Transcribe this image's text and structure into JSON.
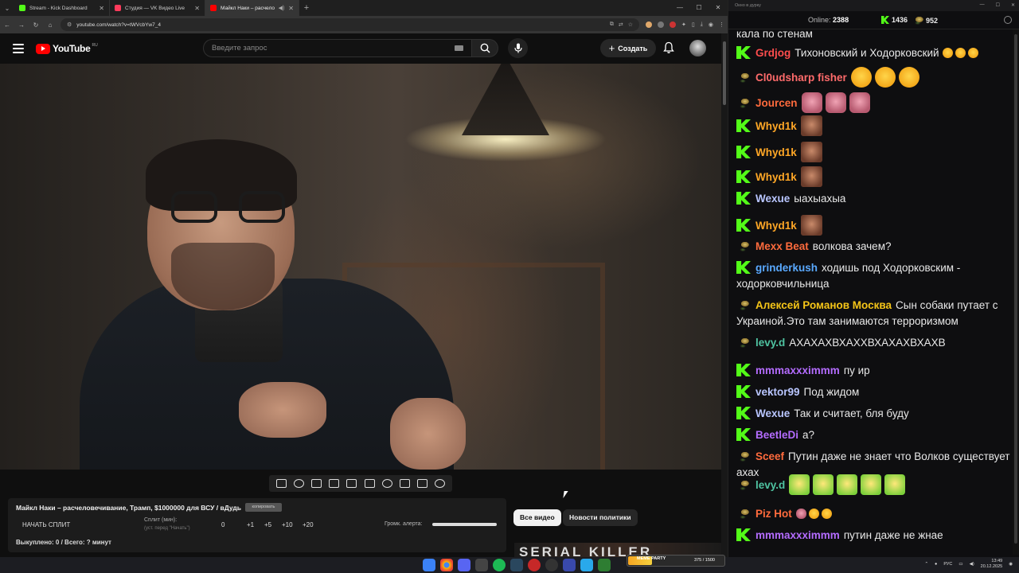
{
  "browser": {
    "tabs": [
      {
        "title": "Stream - Kick Dashboard",
        "color": "#53fc18",
        "active": false
      },
      {
        "title": "Студия — VK Видео Live",
        "color": "#ff3b5c",
        "active": false
      },
      {
        "title": "Майкл Наки – расчелове...",
        "color": "#ff0000",
        "active": true
      }
    ],
    "url": "youtube.com/watch?v=tWVcbYw7_4"
  },
  "youtube": {
    "logo_text": "YouTube",
    "logo_region": "RU",
    "search_placeholder": "Введите запрос",
    "create_label": "Создать"
  },
  "video_panel": {
    "title": "Майкл Наки – расчеловечивание, Трамп, $1000000 для ВСУ / вДудь",
    "copy_label": "копировать",
    "split_button": "НАЧАТЬ СПЛИТ",
    "split_label": "Сплит (мин):",
    "split_hint": "(уст. перед \"Начать\")",
    "steps": [
      "0",
      "+1",
      "+5",
      "+10",
      "+20"
    ],
    "volume_label": "Громк. алерта:",
    "bought": "Выкуплено: 0 / Всего: ? минут"
  },
  "chips": [
    "Все видео",
    "Новости политики"
  ],
  "thumb_text": "SERIAL KILLER",
  "chat": {
    "window_title": "Окно в дурку",
    "online_label": "Online:",
    "online_count": "2388",
    "kick_count": "1436",
    "vk_count": "952",
    "messages": [
      {
        "platform": "",
        "user": "",
        "color": "#e8e8e8",
        "text": "кала по стенам",
        "emotes": ""
      },
      {
        "platform": "kick",
        "user": "Grdjog",
        "color": "#ff4d4d",
        "text": "Тихоновский и Ходорковский",
        "emotes": "laugh-small x3"
      },
      {
        "platform": "vk",
        "user": "Cl0udsharp fisher",
        "color": "#ff6b6b",
        "text": "",
        "emotes": "laugh x3"
      },
      {
        "platform": "vk",
        "user": "Jourcen",
        "color": "#ff6b3d",
        "text": "",
        "emotes": "pink x3"
      },
      {
        "platform": "kick",
        "user": "Whyd1k",
        "color": "#ffa726",
        "text": "",
        "emotes": "face x1"
      },
      {
        "platform": "kick",
        "user": "Whyd1k",
        "color": "#ffa726",
        "text": "",
        "emotes": "face x1"
      },
      {
        "platform": "kick",
        "user": "Whyd1k",
        "color": "#ffa726",
        "text": "",
        "emotes": "face x1"
      },
      {
        "platform": "kick",
        "user": "Wexue",
        "color": "#b9c6ff",
        "text": "ыахыахыа",
        "emotes": ""
      },
      {
        "platform": "kick",
        "user": "Whyd1k",
        "color": "#ffa726",
        "text": "",
        "emotes": "face x1"
      },
      {
        "platform": "vk",
        "user": "Mexx Beat",
        "color": "#ff6b3d",
        "text": "волкова зачем?",
        "emotes": ""
      },
      {
        "platform": "kick",
        "user": "grinderkush",
        "color": "#5aa9ff",
        "text": "ходишь под Ходорковским - ходорковчильница",
        "emotes": ""
      },
      {
        "platform": "vk",
        "user": "Алексей Романов Москва",
        "color": "#f5c518",
        "text": "Сын собаки путает с Украиной.Это там занимаются терроризмом",
        "emotes": ""
      },
      {
        "platform": "vk",
        "user": "levy.d",
        "color": "#4fc3a1",
        "text": "АХАХАХВХАХХВХАХАХВХАХВ",
        "emotes": ""
      },
      {
        "platform": "kick",
        "user": "mmmaxxximmm",
        "color": "#b46cff",
        "text": "пу ир",
        "emotes": ""
      },
      {
        "platform": "kick",
        "user": "vektor99",
        "color": "#b9c6ff",
        "text": "Под жидом",
        "emotes": ""
      },
      {
        "platform": "kick",
        "user": "Wexue",
        "color": "#b9c6ff",
        "text": "Так и считает, бля буду",
        "emotes": ""
      },
      {
        "platform": "kick",
        "user": "BeetleDi",
        "color": "#b46cff",
        "text": "а?",
        "emotes": ""
      },
      {
        "platform": "vk",
        "user": "Sceef",
        "color": "#ff6b3d",
        "text": "Путин даже не знает что Волков существует ахах",
        "emotes": ""
      },
      {
        "platform": "vk",
        "user": "levy.d",
        "color": "#4fc3a1",
        "text": "",
        "emotes": "green x5"
      },
      {
        "platform": "vk",
        "user": "Piz Hot",
        "color": "#ff6b3d",
        "text": "",
        "emotes": "mixed-small x3"
      },
      {
        "platform": "kick",
        "user": "mmmaxxximmm",
        "color": "#b46cff",
        "text": "путин даже не жнае",
        "emotes": ""
      }
    ]
  },
  "kick_goal": {
    "label": "MEME PARTY",
    "value": "375 / 1500",
    "fill_fraction": 0.25
  },
  "taskbar": {
    "lang": "РУС",
    "time": "13:49",
    "date": "20.12.2025"
  }
}
